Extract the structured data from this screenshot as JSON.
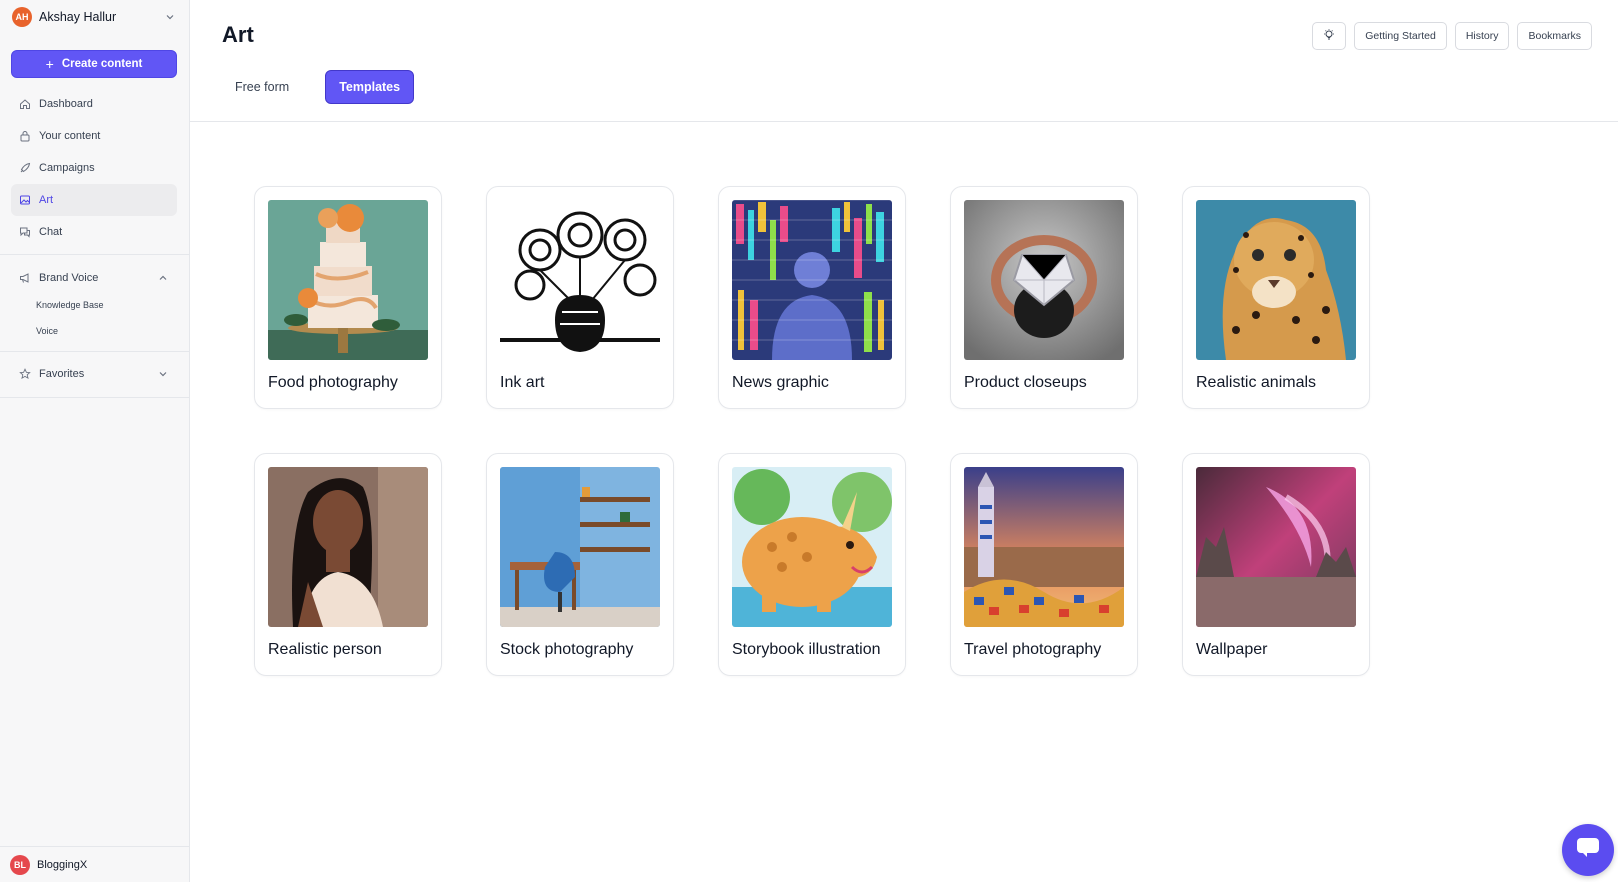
{
  "user": {
    "initials": "AH",
    "name": "Akshay Hallur"
  },
  "create_label": "Create content",
  "nav": [
    {
      "label": "Dashboard",
      "icon": "home-icon"
    },
    {
      "label": "Your content",
      "icon": "lock-icon"
    },
    {
      "label": "Campaigns",
      "icon": "rocket-icon"
    },
    {
      "label": "Art",
      "icon": "image-icon"
    },
    {
      "label": "Chat",
      "icon": "chat-icon"
    }
  ],
  "brand_voice": {
    "label": "Brand Voice",
    "items": [
      "Knowledge Base",
      "Voice"
    ]
  },
  "favorites": {
    "label": "Favorites"
  },
  "workspace": {
    "initials": "BL",
    "name": "BloggingX"
  },
  "page": {
    "title": "Art"
  },
  "tabs": [
    {
      "label": "Free form"
    },
    {
      "label": "Templates"
    }
  ],
  "actions": {
    "getting_started": "Getting Started",
    "history": "History",
    "bookmarks": "Bookmarks"
  },
  "templates": [
    {
      "label": "Food photography"
    },
    {
      "label": "Ink art"
    },
    {
      "label": "News graphic"
    },
    {
      "label": "Product closeups"
    },
    {
      "label": "Realistic animals"
    },
    {
      "label": "Realistic person"
    },
    {
      "label": "Stock photography"
    },
    {
      "label": "Storybook illustration"
    },
    {
      "label": "Travel photography"
    },
    {
      "label": "Wallpaper"
    }
  ],
  "colors": {
    "accent": "#6156f5",
    "sidebar_bg": "#f7f7f8",
    "active_nav_text": "#4f46e5"
  }
}
